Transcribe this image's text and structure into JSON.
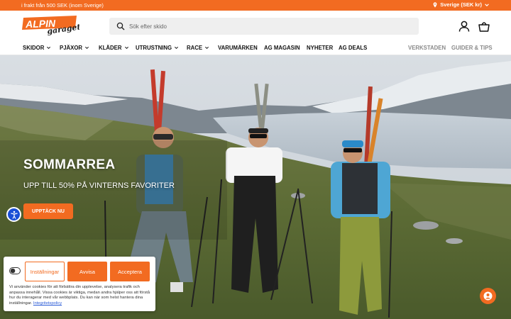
{
  "announcement": {
    "message": "i frakt från 500 SEK (inom Sverige)",
    "region": "Sverige (SEK kr)"
  },
  "brand": {
    "logo_line1": "ALPIN",
    "logo_line2": "garaget",
    "accent": "#f26b21"
  },
  "search": {
    "placeholder": "Sök efter skido"
  },
  "nav": {
    "items": [
      {
        "label": "SKIDOR",
        "dropdown": true
      },
      {
        "label": "PJÄXOR",
        "dropdown": true
      },
      {
        "label": "KLÄDER",
        "dropdown": true
      },
      {
        "label": "UTRUSTNING",
        "dropdown": true
      },
      {
        "label": "RACE",
        "dropdown": true
      },
      {
        "label": "VARUMÄRKEN",
        "dropdown": false
      },
      {
        "label": "AG MAGASIN",
        "dropdown": false
      },
      {
        "label": "NYHETER",
        "dropdown": false
      },
      {
        "label": "AG DEALS",
        "dropdown": false
      }
    ],
    "secondary": [
      "VERKSTADEN",
      "GUIDER & TIPS"
    ]
  },
  "hero": {
    "title": "SOMMARREA",
    "subtitle": "UPP TILL 50% PÅ VINTERNS FAVORITER",
    "cta": "UPPTÄCK NU"
  },
  "cookie": {
    "settings_label": "Inställningar",
    "deny_label": "Avvisa",
    "accept_label": "Acceptera",
    "text": "Vi använder cookies för att förbättra din upplevelse, analysera trafik och anpassa innehåll. Vissa cookies är viktiga, medan andra hjälper oss att förstå hur du interagerar med vår webbplats. Du kan när som helst hantera dina inställningar.",
    "policy_link": "Integritetspolicy"
  }
}
